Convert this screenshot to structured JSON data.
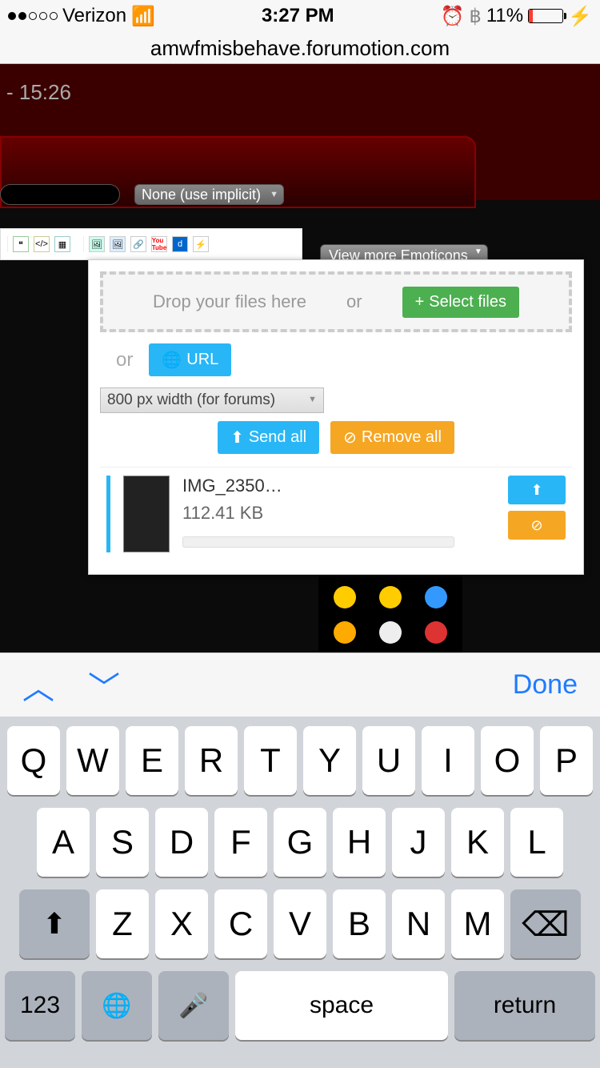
{
  "status": {
    "carrier": "Verizon",
    "time": "3:27 PM",
    "battery_pct": "11%"
  },
  "browser": {
    "url": "amwfmisbehave.forumotion.com"
  },
  "page": {
    "timestamp": "- 15:26",
    "implicit_select": "None (use implicit)",
    "emoticons_btn": "View more Emoticons"
  },
  "upload": {
    "dropzone_text": "Drop your files here",
    "or": "or",
    "select_files": "Select files",
    "url_btn": "URL",
    "size_option": "800 px width (for forums)",
    "send_all": "Send all",
    "remove_all": "Remove all",
    "file": {
      "name": "IMG_2350…",
      "size": "112.41 KB"
    }
  },
  "kb_accessory": {
    "done": "Done"
  },
  "keyboard": {
    "row1": [
      "Q",
      "W",
      "E",
      "R",
      "T",
      "Y",
      "U",
      "I",
      "O",
      "P"
    ],
    "row2": [
      "A",
      "S",
      "D",
      "F",
      "G",
      "H",
      "J",
      "K",
      "L"
    ],
    "row3": [
      "Z",
      "X",
      "C",
      "V",
      "B",
      "N",
      "M"
    ],
    "num": "123",
    "space": "space",
    "ret": "return"
  }
}
